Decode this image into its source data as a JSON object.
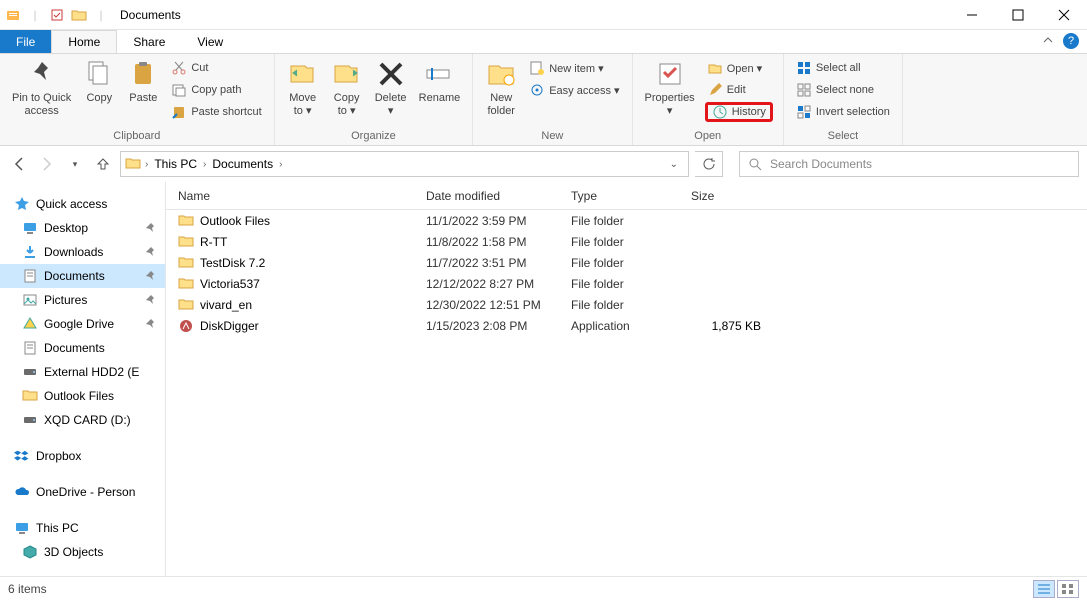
{
  "window": {
    "title": "Documents"
  },
  "tabs": {
    "file": "File",
    "home": "Home",
    "share": "Share",
    "view": "View"
  },
  "ribbon": {
    "clipboard": {
      "label": "Clipboard",
      "pin": "Pin to Quick\naccess",
      "copy": "Copy",
      "paste": "Paste",
      "cut": "Cut",
      "copy_path": "Copy path",
      "paste_shortcut": "Paste shortcut"
    },
    "organize": {
      "label": "Organize",
      "move_to": "Move\nto ▾",
      "copy_to": "Copy\nto ▾",
      "delete": "Delete\n▾",
      "rename": "Rename"
    },
    "new": {
      "label": "New",
      "new_folder": "New\nfolder",
      "new_item": "New item ▾",
      "easy_access": "Easy access ▾"
    },
    "open": {
      "label": "Open",
      "properties": "Properties\n▾",
      "open": "Open ▾",
      "edit": "Edit",
      "history": "History"
    },
    "select": {
      "label": "Select",
      "select_all": "Select all",
      "select_none": "Select none",
      "invert": "Invert selection"
    }
  },
  "breadcrumb": {
    "this_pc": "This PC",
    "documents": "Documents"
  },
  "search": {
    "placeholder": "Search Documents"
  },
  "sidebar": {
    "quick_access": "Quick access",
    "items_qa": [
      {
        "label": "Desktop",
        "pin": true
      },
      {
        "label": "Downloads",
        "pin": true
      },
      {
        "label": "Documents",
        "pin": true,
        "active": true
      },
      {
        "label": "Pictures",
        "pin": true
      },
      {
        "label": "Google Drive",
        "pin": true
      },
      {
        "label": "Documents",
        "pin": false
      },
      {
        "label": "External HDD2 (E",
        "pin": false
      },
      {
        "label": "Outlook Files",
        "pin": false
      },
      {
        "label": "XQD CARD (D:)",
        "pin": false
      }
    ],
    "dropbox": "Dropbox",
    "onedrive": "OneDrive - Person",
    "this_pc": "This PC",
    "this_pc_items": [
      {
        "label": "3D Objects"
      }
    ]
  },
  "columns": {
    "name": "Name",
    "date": "Date modified",
    "type": "Type",
    "size": "Size"
  },
  "rows": [
    {
      "name": "Outlook Files",
      "date": "11/1/2022 3:59 PM",
      "type": "File folder",
      "size": "",
      "icon": "folder"
    },
    {
      "name": "R-TT",
      "date": "11/8/2022 1:58 PM",
      "type": "File folder",
      "size": "",
      "icon": "folder"
    },
    {
      "name": "TestDisk 7.2",
      "date": "11/7/2022 3:51 PM",
      "type": "File folder",
      "size": "",
      "icon": "folder"
    },
    {
      "name": "Victoria537",
      "date": "12/12/2022 8:27 PM",
      "type": "File folder",
      "size": "",
      "icon": "folder"
    },
    {
      "name": "vivard_en",
      "date": "12/30/2022 12:51 PM",
      "type": "File folder",
      "size": "",
      "icon": "folder"
    },
    {
      "name": "DiskDigger",
      "date": "1/15/2023 2:08 PM",
      "type": "Application",
      "size": "1,875 KB",
      "icon": "app"
    }
  ],
  "status": {
    "text": "6 items"
  }
}
